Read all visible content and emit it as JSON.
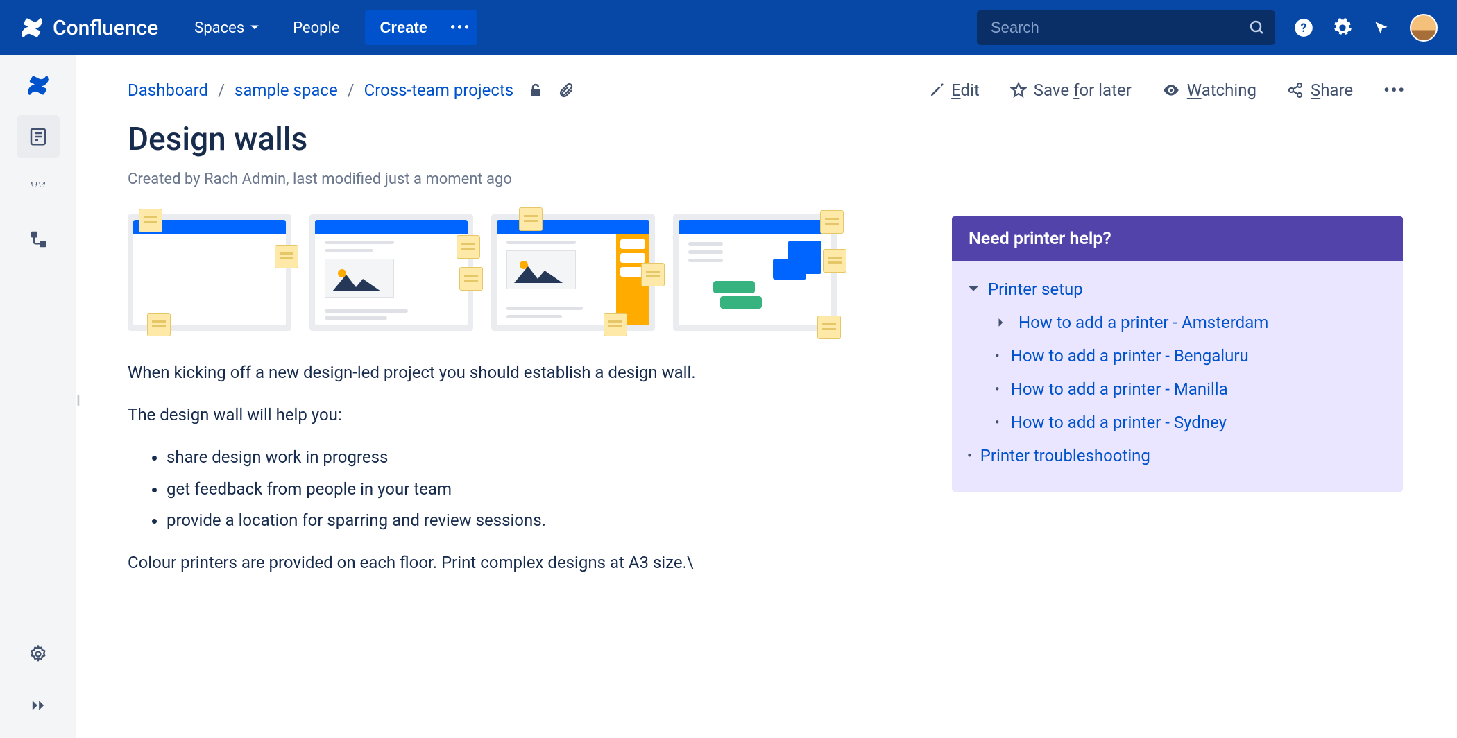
{
  "brand": "Confluence",
  "nav": {
    "spaces": "Spaces",
    "people": "People",
    "create": "Create"
  },
  "search": {
    "placeholder": "Search"
  },
  "breadcrumb": {
    "dashboard": "Dashboard",
    "space": "sample space",
    "parent": "Cross-team projects"
  },
  "actions": {
    "edit": {
      "prefix": "E",
      "rest": "dit"
    },
    "save": {
      "before": "Save ",
      "u": "f",
      "after": "or later"
    },
    "watch": {
      "prefix": "W",
      "rest": "atching"
    },
    "share": {
      "prefix": "S",
      "rest": "hare"
    }
  },
  "page": {
    "title": "Design walls",
    "byline": "Created by Rach Admin, last modified just a moment ago",
    "p1": "When kicking off a new design-led project you should establish a design wall.",
    "p2": "The design wall will help you:",
    "bullets": [
      "share design work in progress",
      "get feedback from people in your team",
      "provide a location for sparring and review sessions."
    ],
    "p3": "Colour printers are provided on each floor. Print complex designs at A3 size.\\"
  },
  "help": {
    "title": "Need printer help?",
    "root": "Printer setup",
    "children": [
      "How to add a printer - Amsterdam",
      "How to add a printer - Bengaluru",
      "How to add a printer - Manilla",
      "How to add a printer - Sydney"
    ],
    "extra": "Printer troubleshooting"
  }
}
